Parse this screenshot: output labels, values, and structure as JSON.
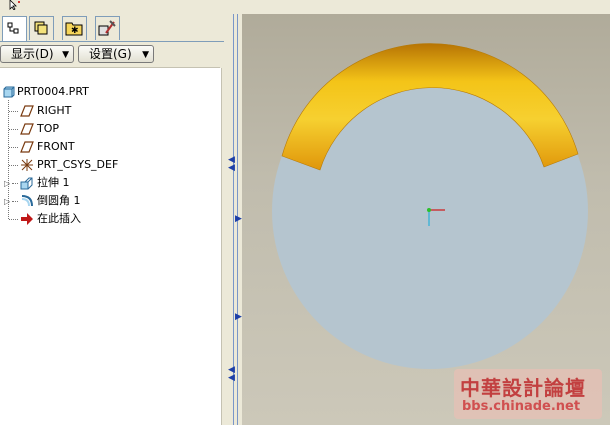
{
  "toolbar": {
    "show_label": "显示(D)",
    "settings_label": "设置(G)"
  },
  "tabs": [
    {
      "icon": "model-tree-icon",
      "active": true
    },
    {
      "icon": "layers-icon",
      "active": false
    },
    {
      "icon": "folder-star-icon",
      "active": false
    },
    {
      "icon": "tools-icon",
      "active": false
    }
  ],
  "tree": {
    "root": "PRT0004.PRT",
    "items": [
      {
        "label": "RIGHT",
        "icon": "datum-plane-icon"
      },
      {
        "label": "TOP",
        "icon": "datum-plane-icon"
      },
      {
        "label": "FRONT",
        "icon": "datum-plane-icon"
      },
      {
        "label": "PRT_CSYS_DEF",
        "icon": "coordinate-system-icon"
      },
      {
        "label": "拉伸 1",
        "icon": "extrude-icon"
      },
      {
        "label": "倒圆角 1",
        "icon": "round-icon"
      },
      {
        "label": "在此插入",
        "icon": "insert-here-arrow-icon"
      }
    ]
  },
  "watermark": {
    "text": "中華設計論壇",
    "url": "bbs.chinade.net"
  },
  "colors": {
    "disk": "#b5c5cf",
    "ring_gold": "#e8a10a",
    "panel_bg": "#ece9d8"
  }
}
